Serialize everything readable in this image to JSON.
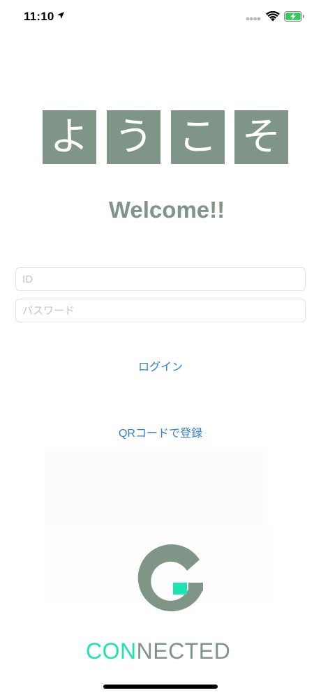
{
  "status_bar": {
    "time": "11:10"
  },
  "welcome_tiles": [
    "よ",
    "う",
    "こ",
    "そ"
  ],
  "welcome_text": "Welcome!!",
  "form": {
    "id_placeholder": "ID",
    "id_value": "",
    "password_placeholder": "パスワード",
    "password_value": ""
  },
  "actions": {
    "login_label": "ログイン",
    "qr_register_label": "QRコードで登録"
  },
  "logo": {
    "brand_text": "CONNECTED",
    "brand_text_accent": "CON",
    "brand_text_rest": "NECTED"
  },
  "colors": {
    "tile_bg": "#7e9588",
    "link": "#2f7fd1",
    "logo_gray": "#7e9588",
    "logo_accent": "#1de3b0"
  }
}
